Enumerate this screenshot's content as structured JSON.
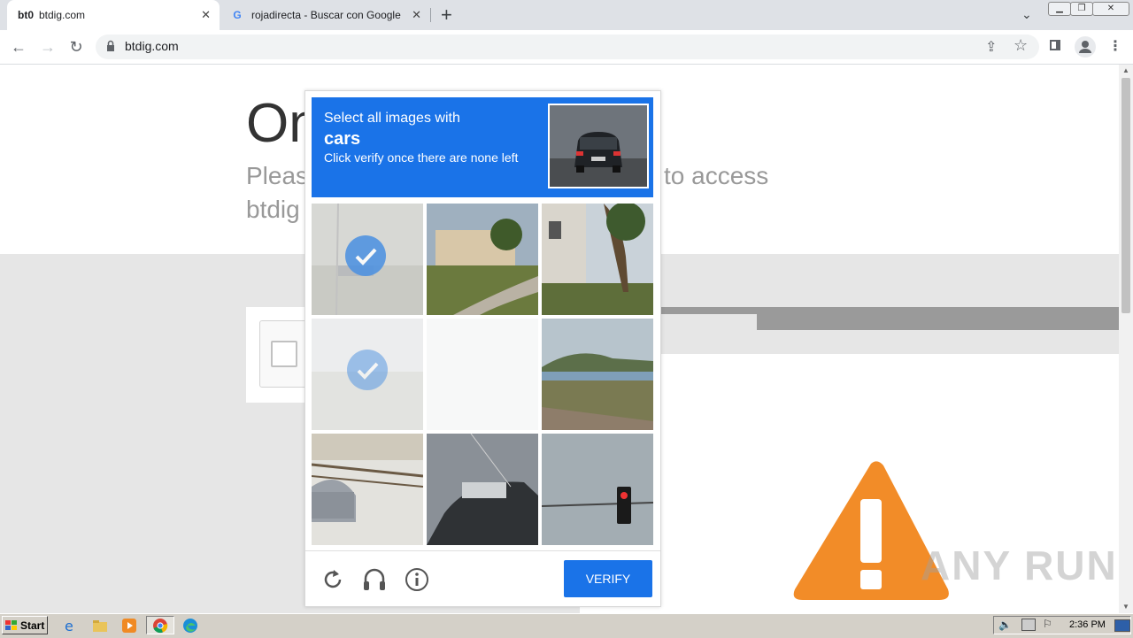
{
  "browser": {
    "tabs": [
      {
        "title": "btdig.com",
        "favicon": "bt0",
        "active": true
      },
      {
        "title": "rojadirecta - Buscar con Google",
        "favicon": "google-icon",
        "active": false
      }
    ],
    "url": "btdig.com"
  },
  "page": {
    "heading": "On",
    "subtext_left": "Pleas",
    "subtext_right": "to access",
    "subtext_line2": "btdig"
  },
  "captcha": {
    "prompt": "Select all images with",
    "target": "cars",
    "instruction": "Click verify once there are none left",
    "verify_label": "VERIFY",
    "tiles": [
      {
        "selected": true
      },
      {
        "selected": false
      },
      {
        "selected": false
      },
      {
        "selected": true
      },
      {
        "selected": false
      },
      {
        "selected": false
      },
      {
        "selected": false
      },
      {
        "selected": false
      },
      {
        "selected": false
      }
    ]
  },
  "watermark": "ANY RUN",
  "taskbar": {
    "start_label": "Start",
    "clock": "2:36 PM"
  },
  "colors": {
    "captcha_blue": "#1a73e8",
    "warning_orange": "#f28c28"
  }
}
